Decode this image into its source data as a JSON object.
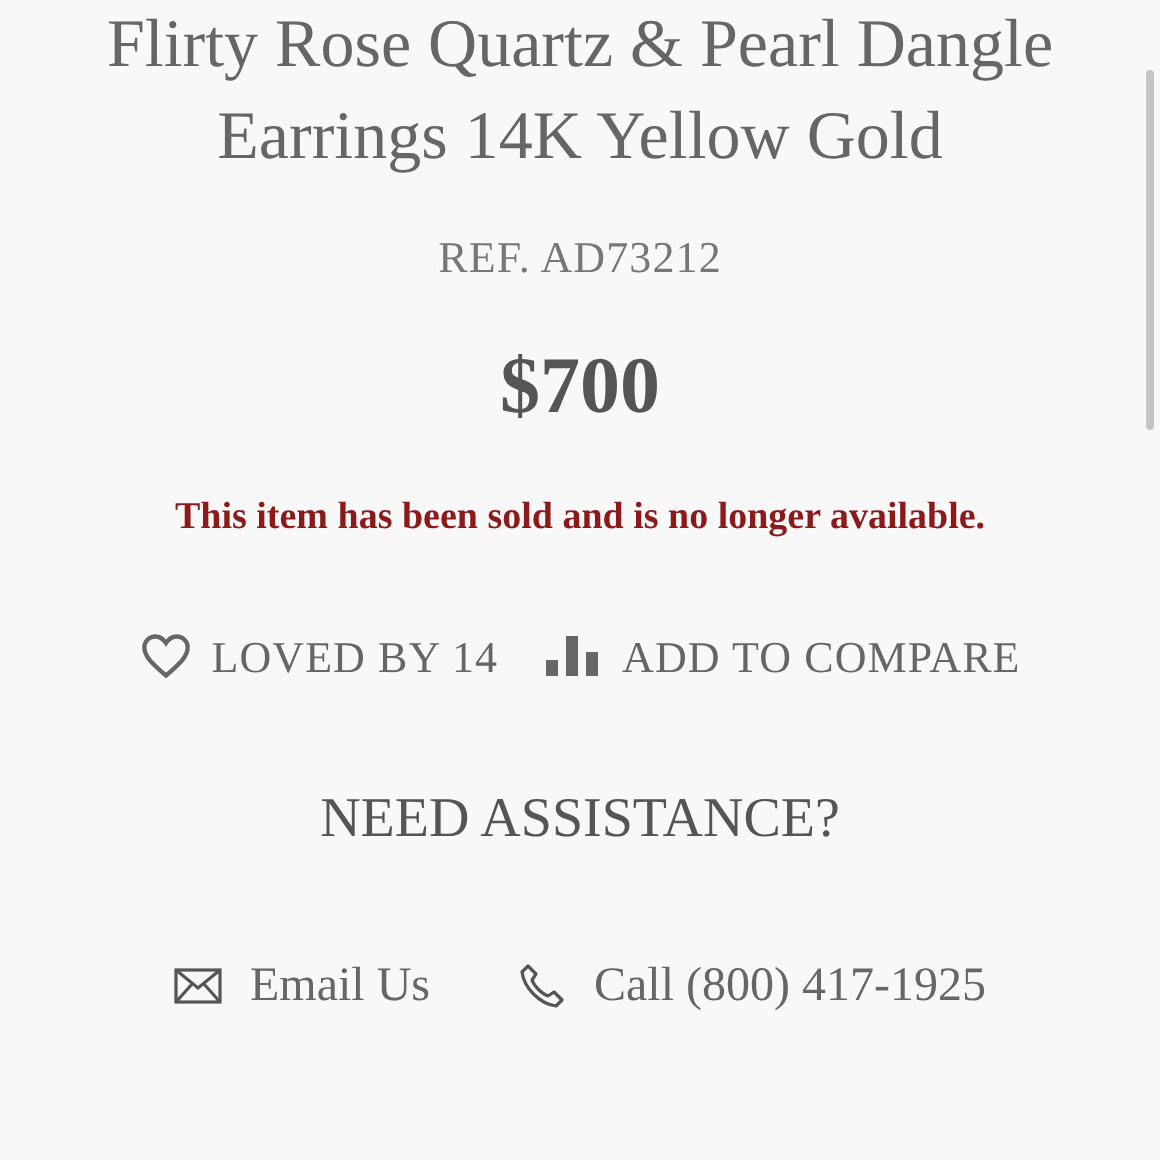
{
  "product": {
    "title": "Flirty Rose Quartz & Pearl Dangle Earrings 14K Yellow Gold",
    "ref": "REF. AD73212",
    "price": "$700",
    "sold_notice": "This item has been sold and is no longer available."
  },
  "actions": [
    {
      "kind": "love",
      "label": "LOVED BY 14"
    },
    {
      "kind": "compare",
      "label": "ADD TO COMPARE"
    }
  ],
  "assistance": {
    "heading": "NEED ASSISTANCE?",
    "contacts": [
      {
        "kind": "email",
        "label": "Email Us"
      },
      {
        "kind": "phone",
        "label": "Call (800) 417-1925"
      }
    ]
  }
}
